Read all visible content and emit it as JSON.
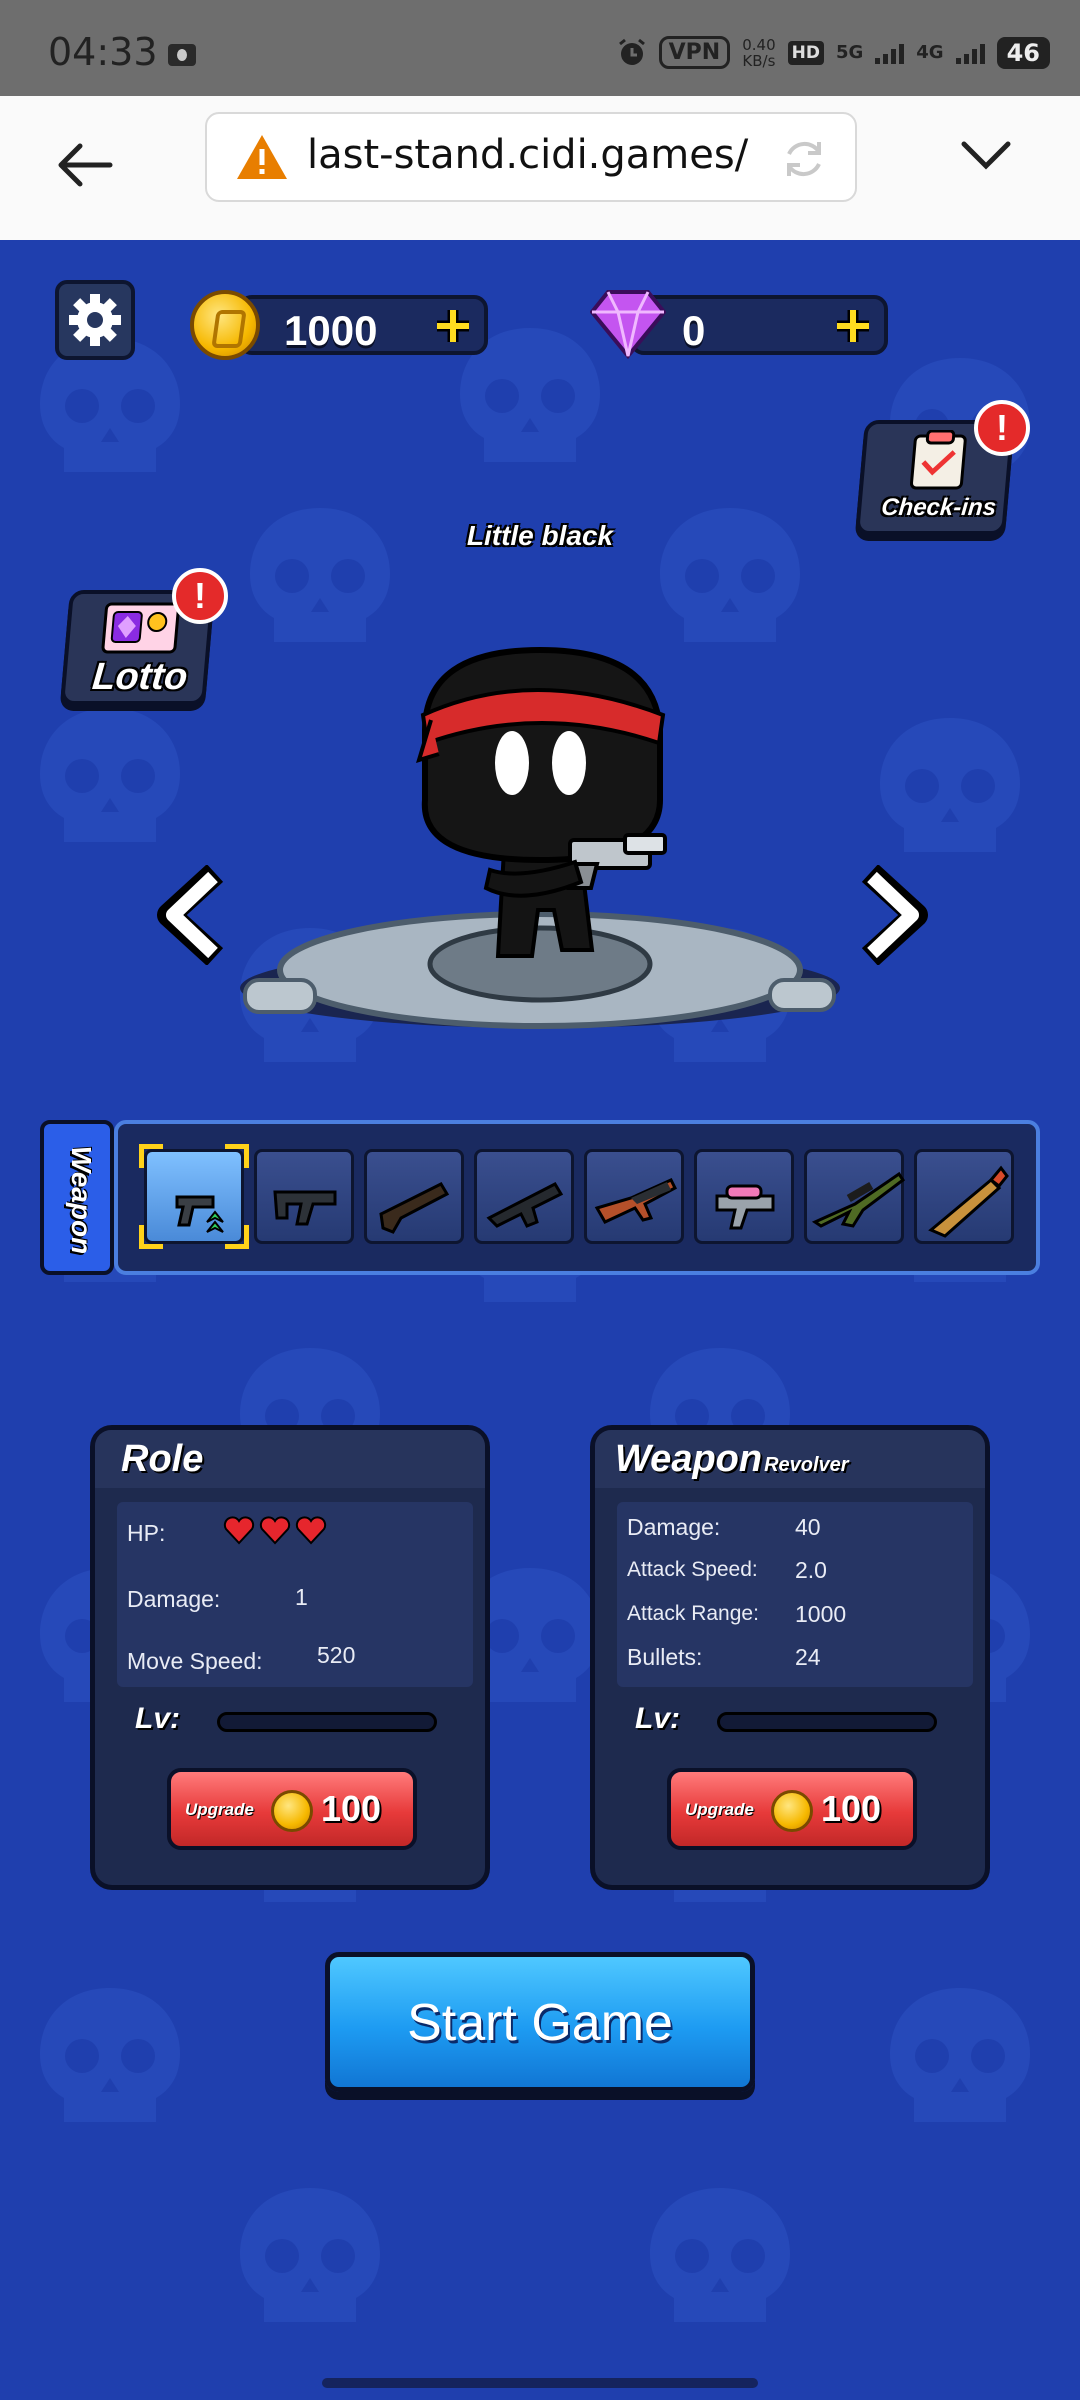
{
  "statusbar": {
    "time": "04:33",
    "vpn": "VPN",
    "speed_top": "0.40",
    "speed_bottom": "KB/s",
    "hd": "HD",
    "net1": "5G",
    "net2": "4G",
    "battery": "46"
  },
  "browser": {
    "url": "last-stand.cidi.games/"
  },
  "currency": {
    "coins": "1000",
    "gems": "0"
  },
  "side": {
    "lotto_label": "Lotto",
    "checkins_label": "Check-ins",
    "alert_glyph": "!"
  },
  "character": {
    "name": "Little black"
  },
  "weapons": {
    "tab_label": "Weapon",
    "slots": [
      "revolver",
      "smg",
      "shotgun",
      "assault-rifle",
      "ak-rifle",
      "pink-blaster",
      "sniper-rifle",
      "rocket-launcher"
    ],
    "selected_index": 0
  },
  "role_panel": {
    "title": "Role",
    "hp_label": "HP:",
    "hp_hearts": 3,
    "damage_label": "Damage:",
    "damage_value": "1",
    "move_label": "Move Speed:",
    "move_value": "520",
    "lv_label": "Lv:",
    "upgrade_label": "Upgrade",
    "upgrade_cost": "100"
  },
  "weapon_panel": {
    "title": "Weapon",
    "subtitle": "Revolver",
    "damage_label": "Damage:",
    "damage_value": "40",
    "attack_speed_label": "Attack Speed:",
    "attack_speed_value": "2.0",
    "attack_range_label": "Attack Range:",
    "attack_range_value": "1000",
    "bullets_label": "Bullets:",
    "bullets_value": "24",
    "lv_label": "Lv:",
    "upgrade_label": "Upgrade",
    "upgrade_cost": "100"
  },
  "start_button": "Start Game",
  "colors": {
    "background": "#1f3fae",
    "accent_red": "#e73a3a",
    "start_blue": "#1d9bf2",
    "gem_purple": "#c455f0"
  }
}
